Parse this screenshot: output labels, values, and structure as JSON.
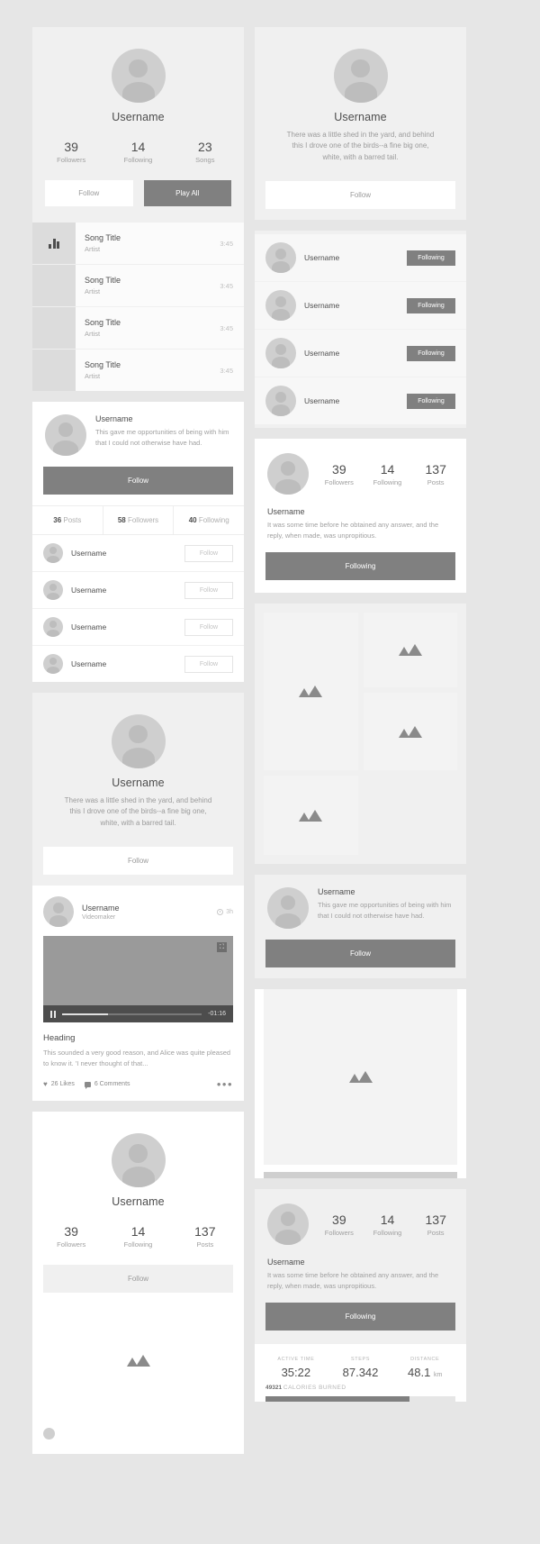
{
  "labels": {
    "username": "Username",
    "follow": "Follow",
    "following": "Following",
    "play_all": "Play All",
    "followers": "Followers",
    "following_lbl": "Following",
    "songs": "Songs",
    "posts": "Posts",
    "artist": "Artist",
    "song_title": "Song Title",
    "duration": "3:45"
  },
  "music_card": {
    "username": "Username",
    "stats": [
      {
        "num": "39",
        "label": "Followers"
      },
      {
        "num": "14",
        "label": "Following"
      },
      {
        "num": "23",
        "label": "Songs"
      }
    ],
    "follow_label": "Follow",
    "play_all_label": "Play All",
    "songs": [
      {
        "title": "Song Title",
        "artist": "Artist",
        "duration": "3:45",
        "playing": true
      },
      {
        "title": "Song Title",
        "artist": "Artist",
        "duration": "3:45",
        "playing": false
      },
      {
        "title": "Song Title",
        "artist": "Artist",
        "duration": "3:45",
        "playing": false
      },
      {
        "title": "Song Title",
        "artist": "Artist",
        "duration": "3:45",
        "playing": false
      }
    ]
  },
  "profile_list_card": {
    "username": "Username",
    "bio": "This gave me opportunities of being with him that I could not otherwise have had.",
    "follow_label": "Follow",
    "tabs": [
      {
        "count": "36",
        "label": "Posts"
      },
      {
        "count": "58",
        "label": "Followers"
      },
      {
        "count": "40",
        "label": "Following"
      }
    ],
    "users": [
      {
        "name": "Username",
        "action": "Follow"
      },
      {
        "name": "Username",
        "action": "Follow"
      },
      {
        "name": "Username",
        "action": "Follow"
      },
      {
        "name": "Username",
        "action": "Follow"
      }
    ]
  },
  "video_card": {
    "username": "Username",
    "bio": "There was a little shed in the yard, and behind this I drove one of the birds--a fine big one, white, with a barred tail.",
    "follow_label": "Follow",
    "post_author": "Username",
    "post_role": "Videomaker",
    "post_time": "3h",
    "remaining": "-01:16",
    "heading": "Heading",
    "description": "This sounded a very good reason, and Alice was quite pleased to know it. 'I never thought of that...",
    "likes": "26 Likes",
    "comments": "6 Comments",
    "more": "•••"
  },
  "bottom_left_card": {
    "username": "Username",
    "stats": [
      {
        "num": "39",
        "label": "Followers"
      },
      {
        "num": "14",
        "label": "Following"
      },
      {
        "num": "137",
        "label": "Posts"
      }
    ],
    "follow_label": "Follow"
  },
  "right_profile_card": {
    "username": "Username",
    "bio": "There was a little shed in the yard, and behind this I drove one of the birds--a fine big one, white, with a barred tail.",
    "follow_label": "Follow"
  },
  "following_list_card": {
    "users": [
      {
        "name": "Username",
        "action": "Following"
      },
      {
        "name": "Username",
        "action": "Following"
      },
      {
        "name": "Username",
        "action": "Following"
      },
      {
        "name": "Username",
        "action": "Following"
      }
    ]
  },
  "gallery_card": {
    "stats": [
      {
        "num": "39",
        "label": "Followers"
      },
      {
        "num": "14",
        "label": "Following"
      },
      {
        "num": "137",
        "label": "Posts"
      }
    ],
    "username": "Username",
    "bio": "It was some time before he obtained any answer, and the reply, when made, was unpropitious.",
    "following_label": "Following",
    "images": [
      "mountain-image",
      "mountain-image",
      "mountain-image",
      "mountain-image"
    ]
  },
  "photo_post_card": {
    "username": "Username",
    "text": "This gave me opportunities of being with him that I could not otherwise have had.",
    "follow_label": "Follow"
  },
  "activity_card": {
    "stats": [
      {
        "num": "39",
        "label": "Followers"
      },
      {
        "num": "14",
        "label": "Following"
      },
      {
        "num": "137",
        "label": "Posts"
      }
    ],
    "username": "Username",
    "bio": "It was some time before he obtained any answer, and the reply, when made, was unpropitious.",
    "following_label": "Following",
    "metrics": [
      {
        "label": "ACTIVE TIME",
        "value": "35:22",
        "unit": ""
      },
      {
        "label": "STEPS",
        "value": "87.342",
        "unit": ""
      },
      {
        "label": "DISTANCE",
        "value": "48.1",
        "unit": "km"
      }
    ],
    "calories_value": "49321",
    "calories_label": "CALORIES BURNED",
    "progress_percent": 76
  },
  "colors": {
    "page_bg": "#e6e6e6",
    "card_bg": "#ffffff",
    "accent_dark": "#808080",
    "text_primary": "#4d4d4d",
    "text_muted": "#a0a0a0"
  }
}
